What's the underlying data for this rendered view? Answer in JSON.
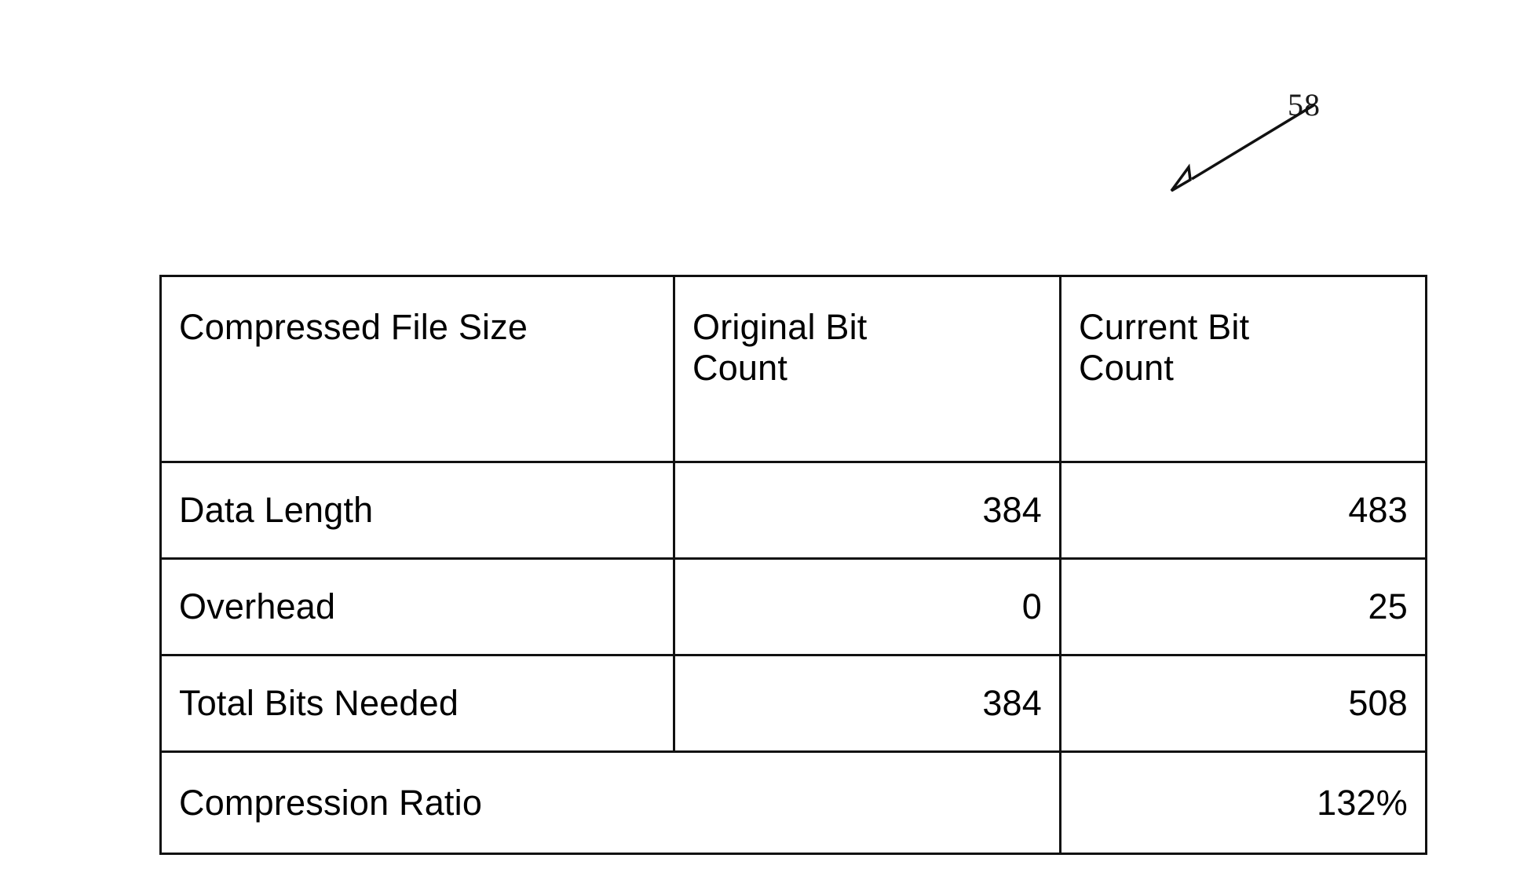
{
  "figure": {
    "reference_numeral": "58",
    "leader_arrow": "arrow pointing down-left toward table"
  },
  "table": {
    "columns": [
      "Compressed File Size",
      "Original Bit Count",
      "Current Bit Count"
    ],
    "header": {
      "col1": "Compressed File Size",
      "col2_line1": "Original Bit",
      "col2_line2": "Count",
      "col3_line1": "Current Bit",
      "col3_line2": "Count"
    },
    "rows": [
      {
        "label": "Data Length",
        "original_bit_count": "384",
        "current_bit_count": "483"
      },
      {
        "label": "Overhead",
        "original_bit_count": "0",
        "current_bit_count": "25"
      },
      {
        "label": "Total Bits Needed",
        "original_bit_count": "384",
        "current_bit_count": "508"
      },
      {
        "label": "Compression Ratio",
        "original_bit_count": "",
        "current_bit_count": "132%"
      }
    ]
  },
  "colors": {
    "ink": "#111111",
    "paper": "#ffffff"
  }
}
